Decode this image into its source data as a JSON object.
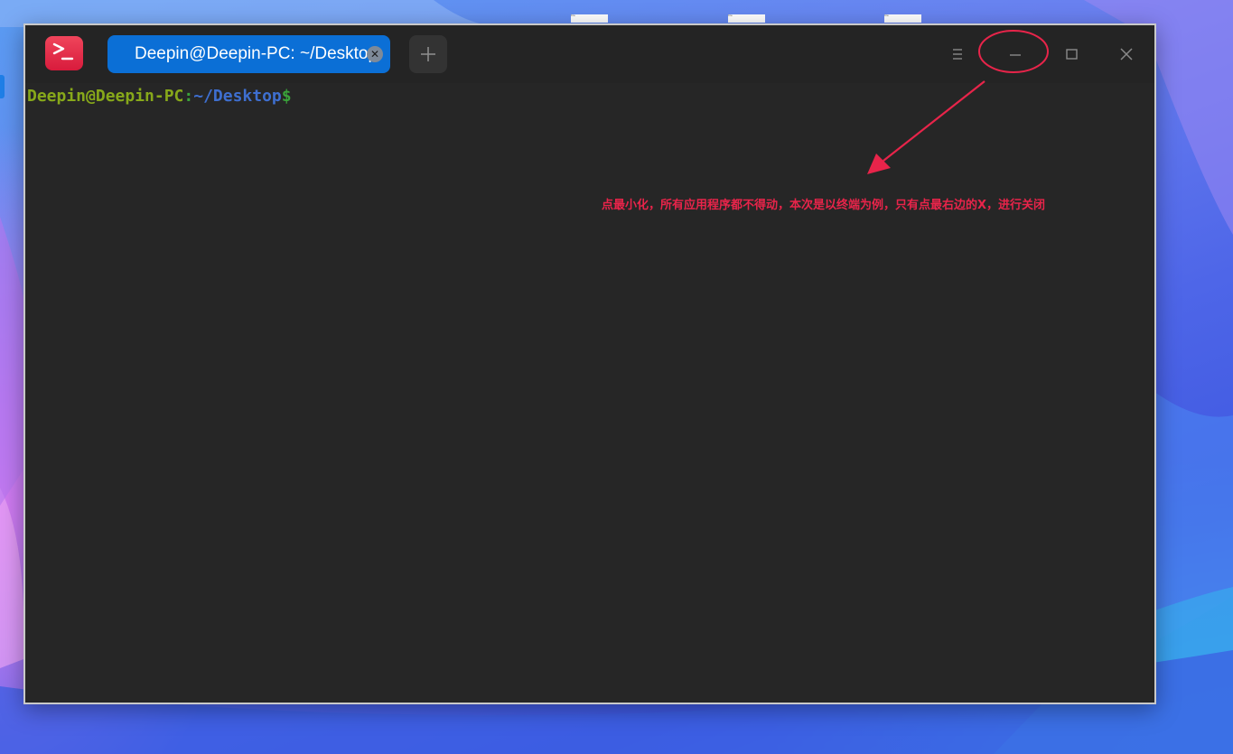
{
  "window": {
    "app_icon": "terminal-app-icon",
    "tab": {
      "title": "Deepin@Deepin-PC: ~/Desktop",
      "close_icon": "close-tab-icon"
    },
    "new_tab_icon": "plus-icon",
    "controls": {
      "menu_icon": "menu-icon",
      "minimize_icon": "minimize-icon",
      "maximize_icon": "maximize-icon",
      "close_icon": "close-icon"
    }
  },
  "terminal": {
    "prompt_user": "Deepin@Deepin-PC",
    "prompt_sep": ":",
    "prompt_path": "~/Desktop",
    "prompt_symbol": "$"
  },
  "annotation": {
    "text": "点最小化，所有应用程序都不得动，本次是以终端为例，只有点最右边的X，进行关闭",
    "color": "#e8244a"
  },
  "colors": {
    "tab_active": "#0b6fd6",
    "window_bg": "#262626",
    "app_icon": "#e0223f",
    "prompt_user": "#87a81a",
    "prompt_path": "#3e6fd0"
  }
}
